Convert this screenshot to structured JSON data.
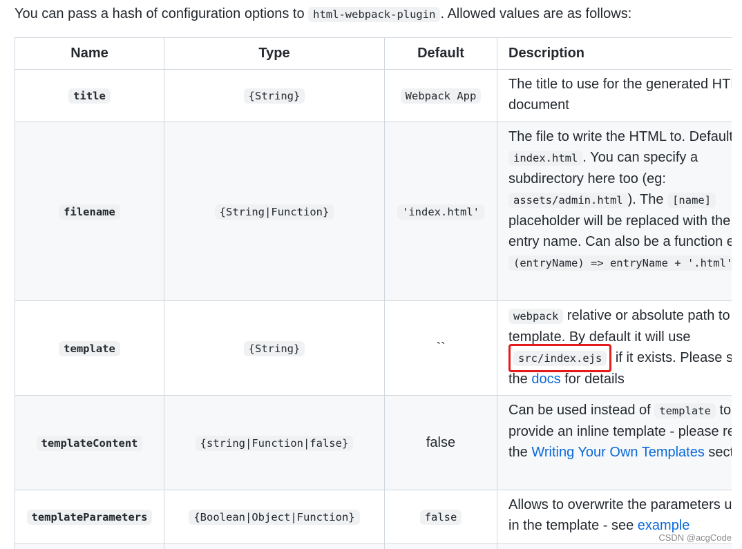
{
  "intro": {
    "before": "You can pass a hash of configuration options to ",
    "code": "html-webpack-plugin",
    "after": ". Allowed values are as follows:"
  },
  "table": {
    "headers": [
      "Name",
      "Type",
      "Default",
      "Description"
    ],
    "rows": [
      {
        "name": "title",
        "type": "{String}",
        "default": "Webpack App",
        "desc": [
          "The title to use for the generated HTML document"
        ]
      },
      {
        "name": "filename",
        "type": "{String|Function}",
        "default": "'index.html'",
        "desc": [
          "The file to write the HTML to. Defaults to ",
          "index.html",
          ". You can specify a subdirectory here too (eg: ",
          "assets/admin.html",
          "). The ",
          "[name]",
          " placeholder will be replaced with the entry name. Can also be a function e.g. ",
          "(entryName) => entryName + '.html'",
          "."
        ]
      },
      {
        "name": "template",
        "type": "{String}",
        "default": "``",
        "desc": [
          "webpack",
          " relative or absolute path to the template. By default it will use ",
          "src/index.ejs",
          " if it exists. Please see the ",
          "docs",
          " for details"
        ]
      },
      {
        "name": "templateContent",
        "type": "{string|Function|false}",
        "default": "false",
        "desc": [
          "Can be used instead of ",
          "template",
          " to provide an inline template - please read the ",
          "Writing Your Own Templates",
          " section"
        ]
      },
      {
        "name": "templateParameters",
        "type": "{Boolean|Object|Function}",
        "default": "false",
        "desc": [
          "Allows to overwrite the parameters used in the template - see ",
          "example"
        ]
      }
    ]
  },
  "watermark": "CSDN @acgCode",
  "colors": {
    "link": "#0969da",
    "highlight_box": "#e31b1b",
    "border": "#d0d7de",
    "stripe": "#f6f8fa"
  }
}
